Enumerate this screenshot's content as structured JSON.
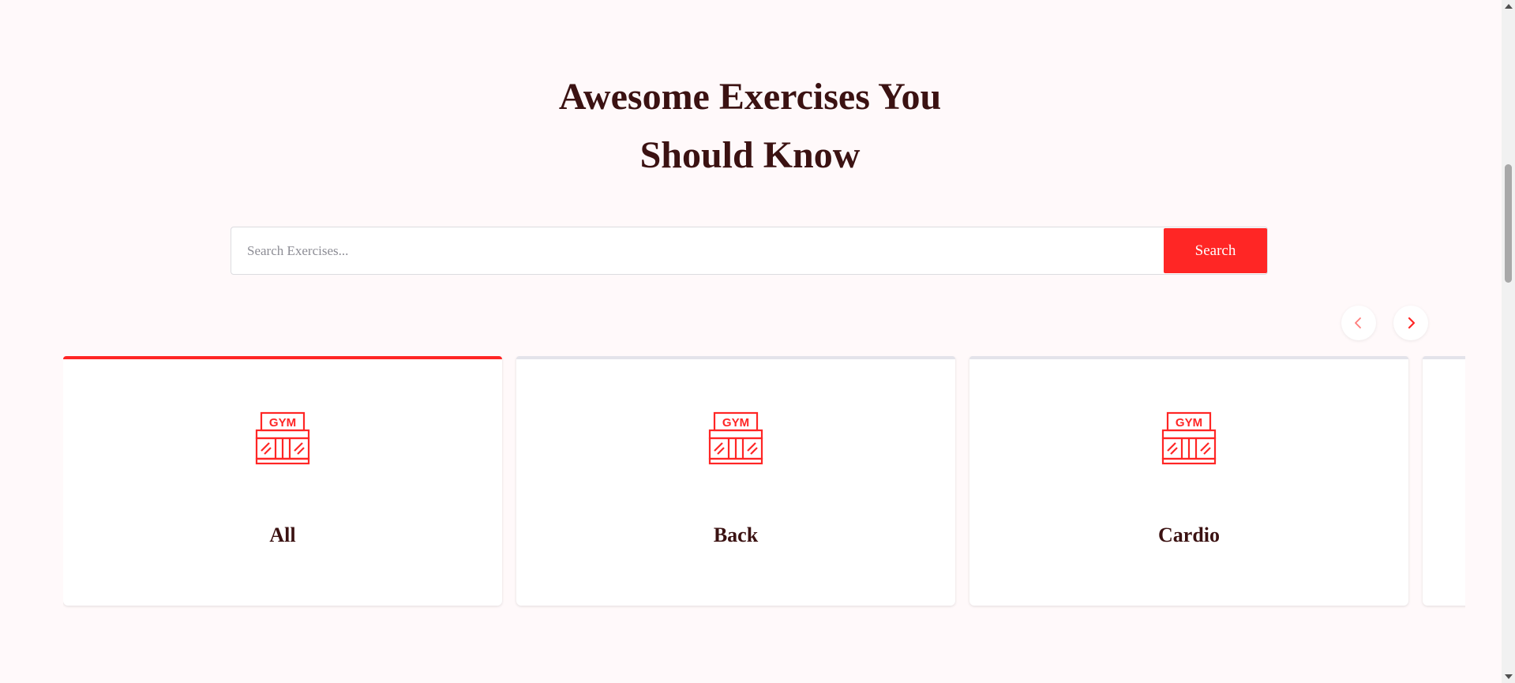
{
  "heading": {
    "line1": "Awesome Exercises You",
    "line2": "Should Know"
  },
  "search": {
    "placeholder": "Search Exercises...",
    "value": "",
    "button_label": "Search"
  },
  "carousel": {
    "prev_icon": "chevron-left-icon",
    "next_icon": "chevron-right-icon",
    "items": [
      {
        "label": "All",
        "icon": "gym-icon",
        "selected": true
      },
      {
        "label": "Back",
        "icon": "gym-icon",
        "selected": false
      },
      {
        "label": "Cardio",
        "icon": "gym-icon",
        "selected": false
      },
      {
        "label": "",
        "icon": "gym-icon",
        "selected": false
      }
    ]
  },
  "colors": {
    "accent": "#ff2625",
    "heading": "#3b1212",
    "background": "#fff9fa"
  }
}
